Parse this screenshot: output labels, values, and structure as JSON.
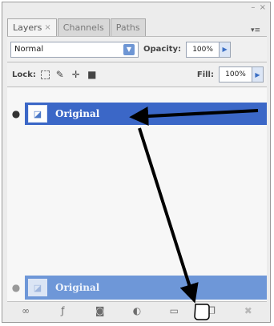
{
  "panel": {
    "tabs": [
      {
        "label": "Layers",
        "close": "×"
      },
      {
        "label": "Channels"
      },
      {
        "label": "Paths"
      }
    ]
  },
  "blend_mode": {
    "value": "Normal"
  },
  "opacity": {
    "label": "Opacity:",
    "value": "100%"
  },
  "lock": {
    "label": "Lock:"
  },
  "fill": {
    "label": "Fill:",
    "value": "100%"
  },
  "layers": [
    {
      "name": "Original",
      "state": "selected"
    },
    {
      "name": "Original",
      "state": "dragging"
    }
  ],
  "footer_icons": [
    "link-icon",
    "fx-icon",
    "mask-icon",
    "adjustment-icon",
    "group-icon",
    "new-layer-icon",
    "trash-icon"
  ],
  "colors": {
    "selection": "#3b67c7",
    "drag_ghost": "#6e97d8",
    "arrow": "#000000"
  }
}
